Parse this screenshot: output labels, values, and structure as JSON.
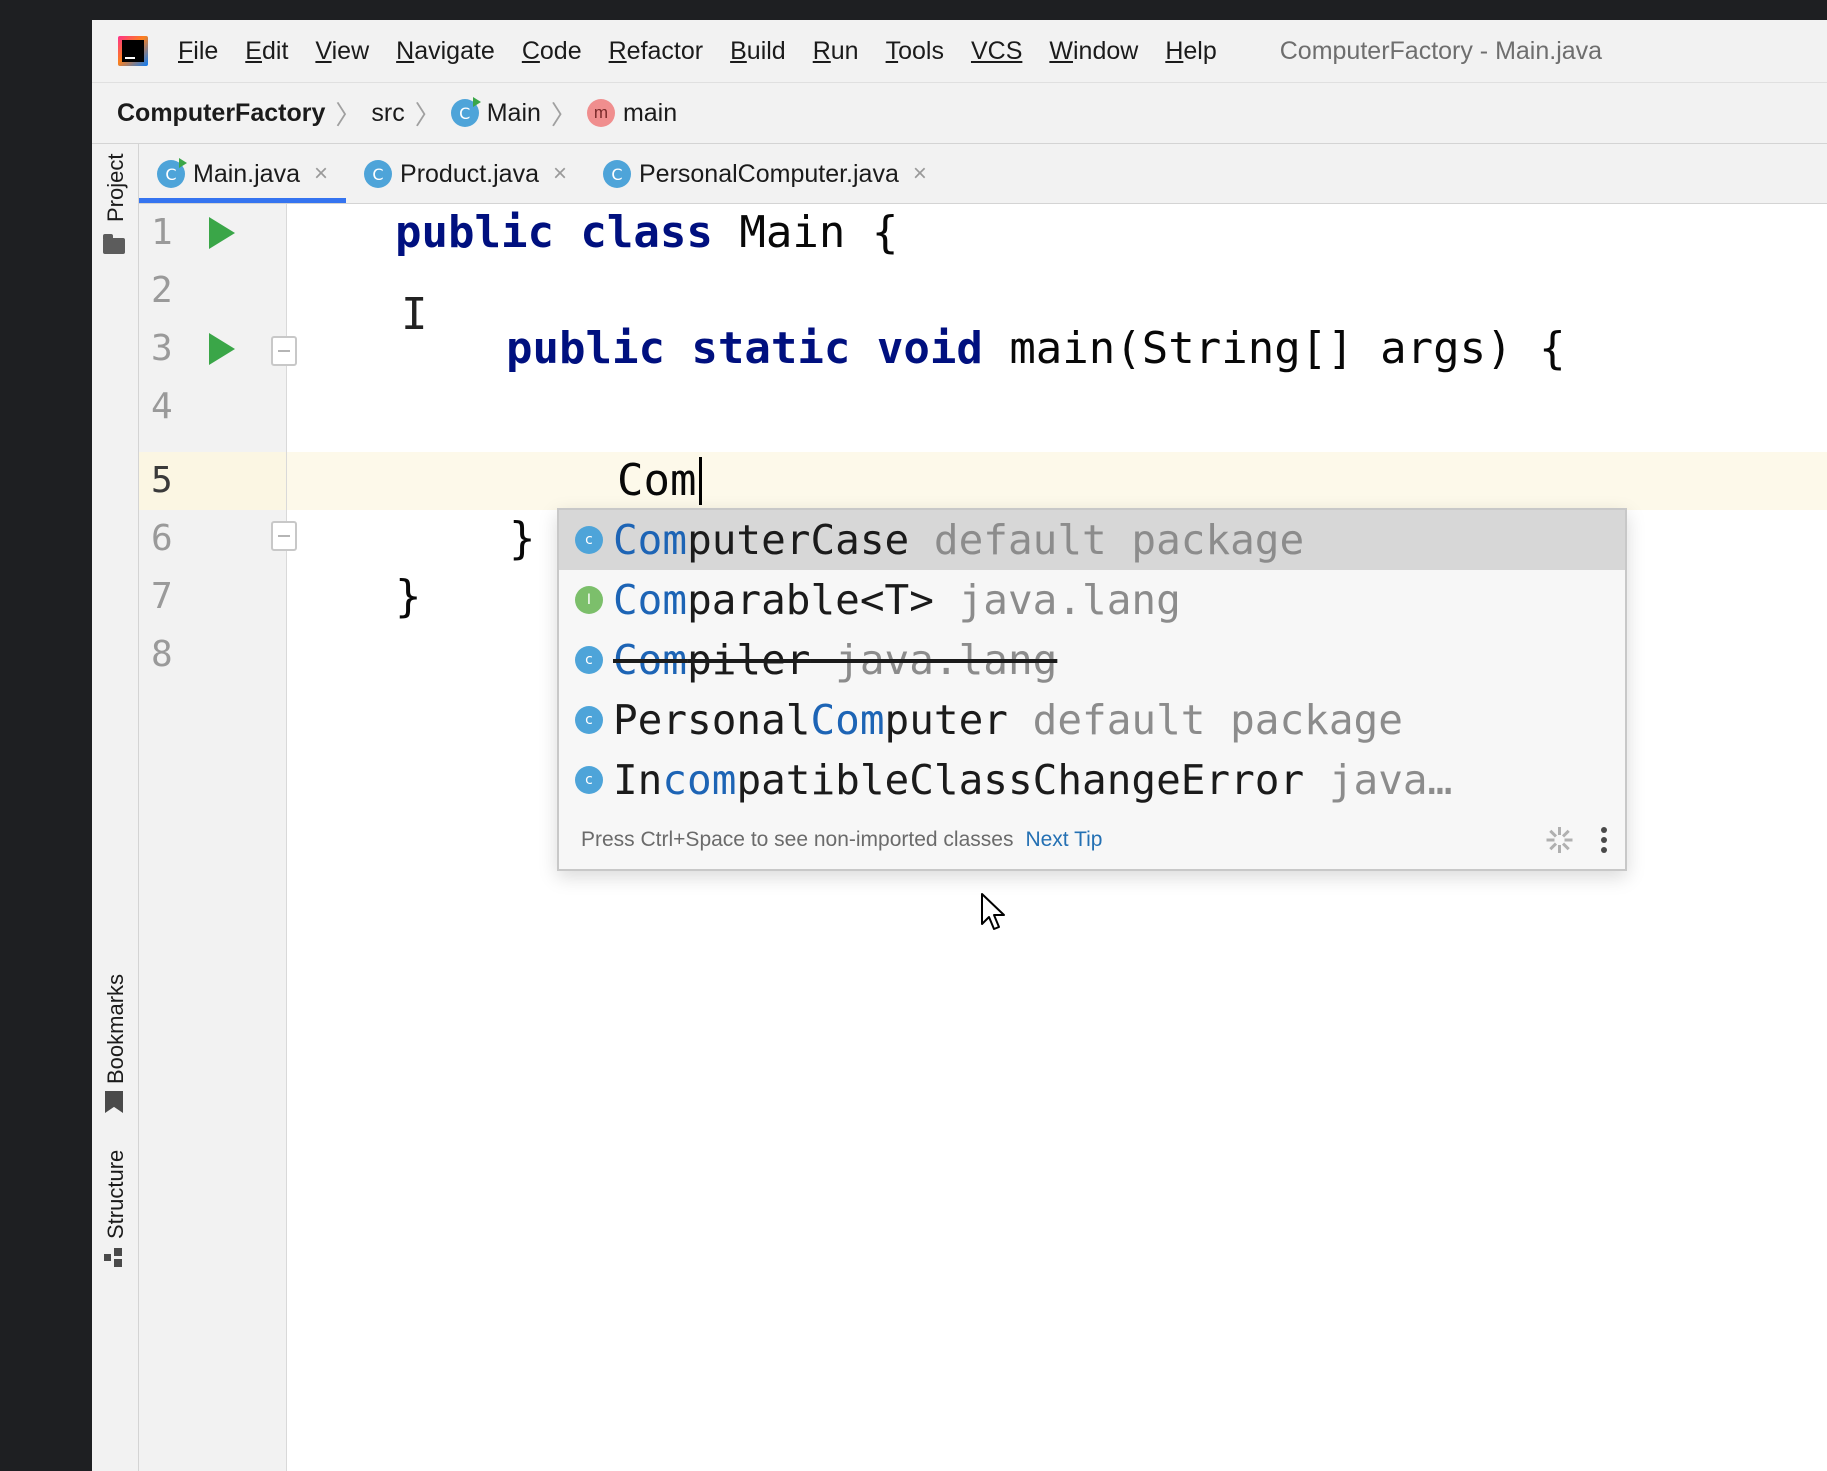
{
  "window_title": "ComputerFactory - Main.java",
  "menu": [
    {
      "mnemonic": "F",
      "rest": "ile"
    },
    {
      "mnemonic": "E",
      "rest": "dit"
    },
    {
      "mnemonic": "V",
      "rest": "iew"
    },
    {
      "mnemonic": "N",
      "rest": "avigate"
    },
    {
      "mnemonic": "C",
      "rest": "ode"
    },
    {
      "mnemonic": "R",
      "rest": "efactor"
    },
    {
      "mnemonic": "B",
      "rest": "uild"
    },
    {
      "mnemonic": "R",
      "rest": "un"
    },
    {
      "mnemonic": "T",
      "rest": "ools"
    },
    {
      "mnemonic": "VCS",
      "rest": ""
    },
    {
      "mnemonic": "W",
      "rest": "indow"
    },
    {
      "mnemonic": "H",
      "rest": "elp"
    }
  ],
  "breadcrumb": {
    "project": "ComputerFactory",
    "folder": "src",
    "class": "Main",
    "method": "main",
    "class_icon": "C",
    "method_icon": "m"
  },
  "tool_strip": {
    "project": "Project",
    "bookmarks": "Bookmarks",
    "structure": "Structure"
  },
  "tabs": [
    {
      "label": "Main.java",
      "icon": "C",
      "active": true
    },
    {
      "label": "Product.java",
      "icon": "C",
      "active": false
    },
    {
      "label": "PersonalComputer.java",
      "icon": "C",
      "active": false
    }
  ],
  "tab_close_glyph": "×",
  "editor": {
    "line_numbers": [
      "1",
      "2",
      "3",
      "4",
      "5",
      "6",
      "7",
      "8"
    ],
    "current_line": 5,
    "lines": {
      "l1_kw": "public class",
      "l1_rest": " Main {",
      "l3_kw": "public static void",
      "l3_rest": " main(String[] args) {",
      "l5_text": "Com",
      "l6_text": "}",
      "l7_text": "}"
    },
    "ibeam_glyph": "I"
  },
  "completion": {
    "items": [
      {
        "icon": "c",
        "kind": "class",
        "match": "Com",
        "name_rest": "puterCase",
        "prefix": "",
        "type": " default package",
        "selected": true,
        "deprecated": false
      },
      {
        "icon": "I",
        "kind": "interface",
        "match": "Com",
        "name_rest": "parable<T>",
        "prefix": "",
        "type": " java.lang",
        "selected": false,
        "deprecated": false
      },
      {
        "icon": "c",
        "kind": "class",
        "match": "Com",
        "name_rest": "piler",
        "prefix": "",
        "type": " java.lang",
        "selected": false,
        "deprecated": true
      },
      {
        "icon": "c",
        "kind": "class",
        "match": "Com",
        "name_rest": "puter",
        "prefix": "Personal",
        "type": " default package",
        "selected": false,
        "deprecated": false
      },
      {
        "icon": "c",
        "kind": "class",
        "match": "com",
        "name_rest": "patibleClassChangeError",
        "prefix": "In",
        "type": " java…",
        "selected": false,
        "deprecated": false
      }
    ],
    "footer_hint": "Press Ctrl+Space to see non-imported classes",
    "footer_tip": "Next Tip"
  },
  "colors": {
    "keyword": "#00107f",
    "match_highlight": "#1d64b5",
    "run_icon": "#3aa648",
    "class_icon": "#4ea4d9",
    "interface_icon": "#7cbf6b",
    "active_tab_underline": "#3574f0",
    "current_line_bg": "#fdf9ea"
  }
}
